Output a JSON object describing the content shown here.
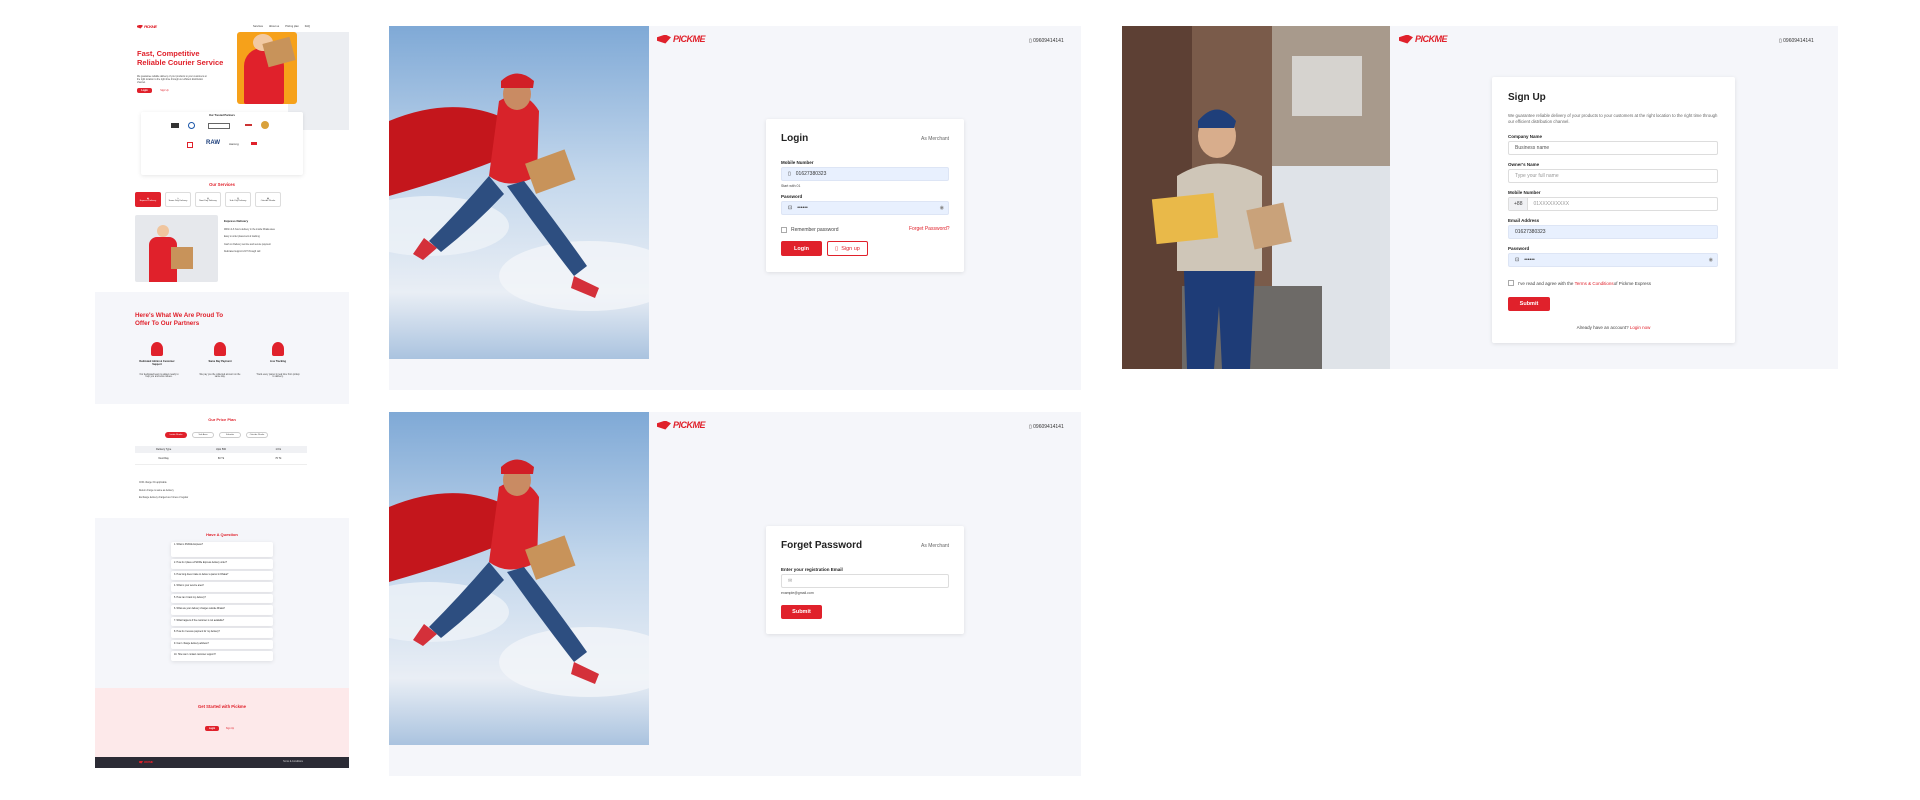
{
  "brand": {
    "name": "PICKME",
    "sub": "EXPRESS"
  },
  "phone": "09609414141",
  "landing": {
    "nav": [
      "Services",
      "About us",
      "Pricing plan",
      "FAQ"
    ],
    "hero": {
      "title_line1": "Fast, Competitive",
      "title_line2": "Reliable Courier Service",
      "sub": "We guarantee reliable delivery of your products to your customers at the right location to the right time through our efficient distribution channel.",
      "btn_primary": "Login",
      "btn_secondary": "Sign Up"
    },
    "partners_title": "Our Trusted Partners",
    "partners": [
      "BATA",
      "Partner",
      "Partner",
      "Apex",
      "BD",
      "RAW",
      "Aarong",
      "Partner",
      "Partner"
    ],
    "services_title": "Our Services",
    "service_tabs": [
      "Express Delivery",
      "Same Day Delivery",
      "Next Day Delivery",
      "Sub City Delivery",
      "Outside Dhaka"
    ],
    "service_detail": {
      "title": "Express Delivery",
      "points": [
        "Within 4-6 hours delivery in the inside Dhaka area",
        "Easy to order placement & tracking",
        "Cash on Delivery service and secure payment",
        "Dedicated support 24/7 through call"
      ]
    },
    "proud": {
      "title_line1": "Here's What We Are Proud To",
      "title_line2": "Offer To Our Partners",
      "items": [
        {
          "title": "Dedicated Admin & Customer Support",
          "desc": "Our dedicated team is always ready to help you and solve issues."
        },
        {
          "title": "Same Day Payment",
          "desc": "We pay you the collected amount on the same day."
        },
        {
          "title": "Live Tracking",
          "desc": "Track every parcel in real time from pickup to delivery."
        }
      ]
    },
    "price": {
      "title": "Our Price Plan",
      "tabs": [
        "Inside Dhaka",
        "Sub Area",
        "Suburbs",
        "Outside Dhaka"
      ],
      "headers": [
        "Delivery Type",
        "Upto 500",
        "1 KG"
      ],
      "row": [
        "Next Day",
        "60 Tk",
        "70 Tk"
      ],
      "notes": [
        "COD charge 1% applicable",
        "Return charge is same as delivery",
        "Exchange delivery charged as 2 times of regular"
      ]
    },
    "faq": {
      "title": "Have A Question",
      "items": [
        "1. What is PicKMe Express?",
        "2. How do I place a PicKMe Express delivery order?",
        "3. How long does it take to deliver a parcel in Dhaka?",
        "4. What is your service area?",
        "5. How can I track my delivery?",
        "6. What are your delivery charges outside Dhaka?",
        "7. What happens if the customer is not available?",
        "8. How do I receive payment for my delivery?",
        "9. Can I change delivery address?",
        "10. How can I contact customer support?"
      ]
    },
    "cta": {
      "title": "Get Started with Pickme",
      "btn_primary": "Login",
      "btn_secondary": "Sign Up"
    },
    "footer": {
      "right": "Terms & Conditions"
    }
  },
  "login": {
    "title": "Login",
    "role": "As Merchant",
    "mobile_label": "Mobile Number",
    "mobile_value": "01627380323",
    "mobile_hint": "Start with 01",
    "password_label": "Password",
    "password_value": "••••••",
    "remember": "Remember password",
    "forgot": "Forget Password?",
    "login_btn": "Login",
    "signup_btn": "Sign up"
  },
  "forgot": {
    "title": "Forget Password",
    "role": "As Merchant",
    "email_label": "Enter your registration Email",
    "email_placeholder": "",
    "email_hint": "example@gmail.com",
    "submit": "Submit"
  },
  "signup": {
    "title": "Sign Up",
    "desc": "We guarantee reliable delivery of your products to your customers at the right location to the right time through our efficient distribution channel.",
    "company_label": "Company Name",
    "company_placeholder": "Business name",
    "owner_label": "Owner's Name",
    "owner_placeholder": "Type your full name",
    "mobile_label": "Mobile Number",
    "mobile_prefix": "+88",
    "mobile_placeholder": "01XXXXXXXXX",
    "email_label": "Email Address",
    "email_value": "01627380323",
    "password_label": "Password",
    "password_value": "••••••",
    "agree_prefix": "I've read and agree with the ",
    "agree_link": "Terms & Conditions",
    "agree_suffix": " of Pickme Express",
    "submit": "Submit",
    "already": "Already have an account?",
    "login_link": "Login now"
  },
  "colors": {
    "accent": "#e0212b",
    "panel": "#f5f6fa"
  }
}
